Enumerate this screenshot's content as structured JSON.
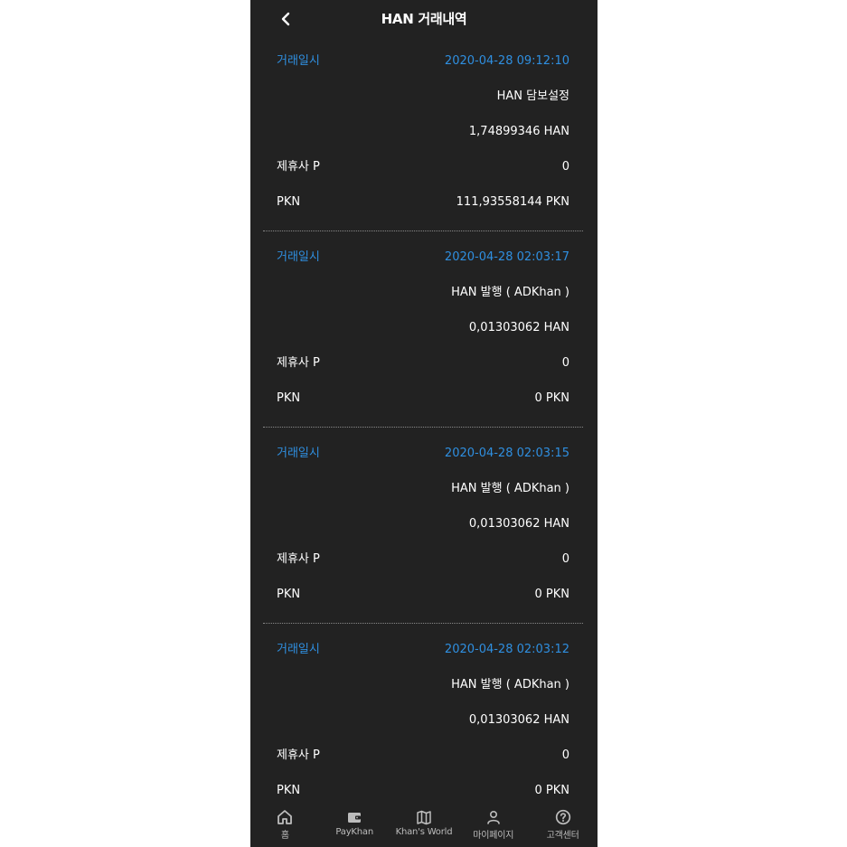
{
  "header": {
    "title": "HAN 거래내역"
  },
  "colors": {
    "background": "#222222",
    "date_accent": "#2f8fe0",
    "text": "#ffffff",
    "separator": "#8a8a8a"
  },
  "transactions": [
    {
      "date_label": "거래일시",
      "date": "2020-04-28 09:12:10",
      "type": "HAN 담보설정",
      "amount": "1,74899346 HAN",
      "partner_label": "제휴사 P",
      "partner_value": "0",
      "pkn_label": "PKN",
      "pkn_value": "111,93558144 PKN"
    },
    {
      "date_label": "거래일시",
      "date": "2020-04-28 02:03:17",
      "type": "HAN 발행 ( ADKhan )",
      "amount": "0,01303062 HAN",
      "partner_label": "제휴사 P",
      "partner_value": "0",
      "pkn_label": "PKN",
      "pkn_value": "0 PKN"
    },
    {
      "date_label": "거래일시",
      "date": "2020-04-28 02:03:15",
      "type": "HAN 발행 ( ADKhan )",
      "amount": "0,01303062 HAN",
      "partner_label": "제휴사 P",
      "partner_value": "0",
      "pkn_label": "PKN",
      "pkn_value": "0 PKN"
    },
    {
      "date_label": "거래일시",
      "date": "2020-04-28 02:03:12",
      "type": "HAN 발행 ( ADKhan )",
      "amount": "0,01303062 HAN",
      "partner_label": "제휴사 P",
      "partner_value": "0",
      "pkn_label": "PKN",
      "pkn_value": "0 PKN"
    }
  ],
  "tabbar": {
    "items": [
      {
        "label": "홈",
        "icon": "home-icon"
      },
      {
        "label": "PayKhan",
        "icon": "wallet-icon"
      },
      {
        "label": "Khan's World",
        "icon": "map-icon"
      },
      {
        "label": "마이페이지",
        "icon": "user-icon"
      },
      {
        "label": "고객센터",
        "icon": "help-icon"
      }
    ]
  }
}
